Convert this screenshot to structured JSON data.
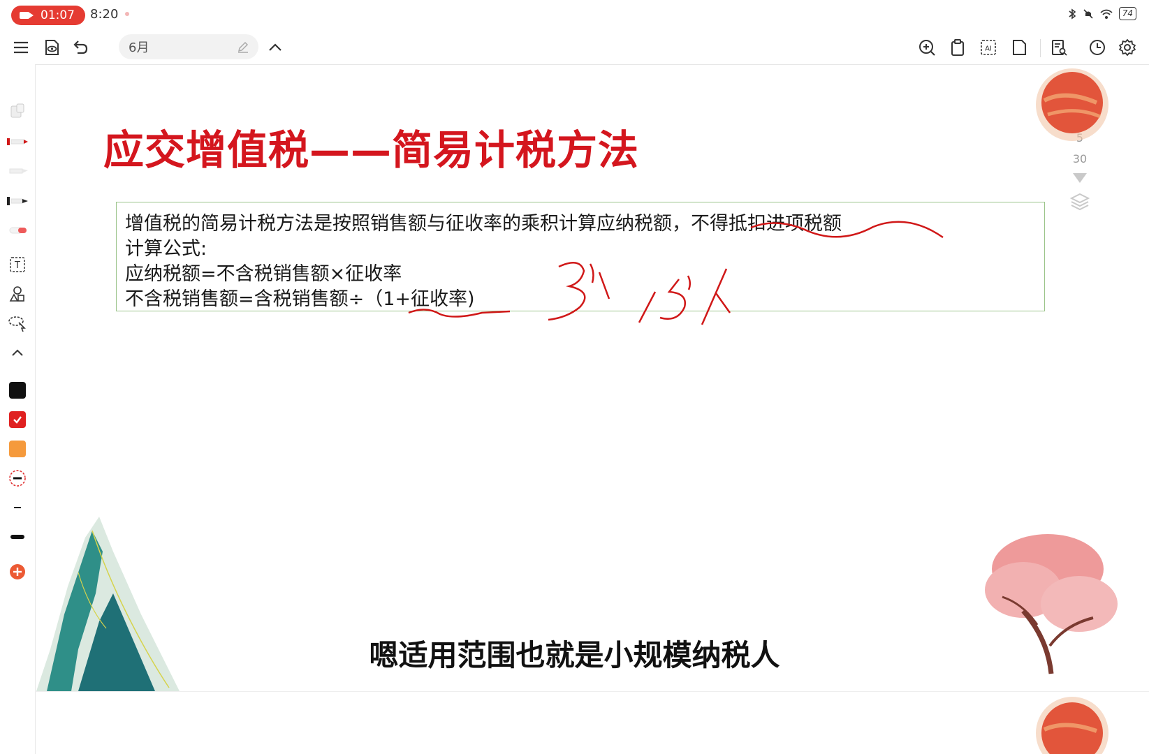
{
  "status_bar": {
    "record_time": "01:07",
    "clock": "8:20",
    "battery": "74",
    "record_color": "#e53b32"
  },
  "toolbar": {
    "notebook_title": "6月",
    "left_icons": [
      "menu-icon",
      "view-mode-icon",
      "undo-icon"
    ],
    "right_icons": [
      "zoom-in-icon",
      "clipboard-icon",
      "ai-icon",
      "page-icon",
      "notes-search-icon",
      "history-icon",
      "settings-icon"
    ]
  },
  "left_rail": {
    "tools": [
      "eraser-icon",
      "pen-icon",
      "highlighter-icon",
      "marker-icon",
      "lasso-pen-icon",
      "text-tool-icon",
      "shapes-icon",
      "lasso-select-icon",
      "collapse-icon"
    ],
    "colors": [
      "#111111",
      "#e02020",
      "#f59a3c"
    ],
    "selected_color": "#e02020"
  },
  "slide": {
    "title": "应交增值税——简易计税方法",
    "title_color": "#d4161e",
    "lines": [
      "增值税的简易计税方法是按照销售额与征收率的乘积计算应纳税额，不得抵扣进项税额",
      "计算公式:",
      "应纳税额=不含税销售额×征收率",
      "不含税销售额=含税销售额÷（1+征收率)"
    ],
    "handwriting": [
      "3%",
      "15%"
    ],
    "ink_color": "#d01818"
  },
  "page_nav": {
    "current": "5",
    "total": "30"
  },
  "subtitle": "嗯适用范围也就是小规模纳税人"
}
